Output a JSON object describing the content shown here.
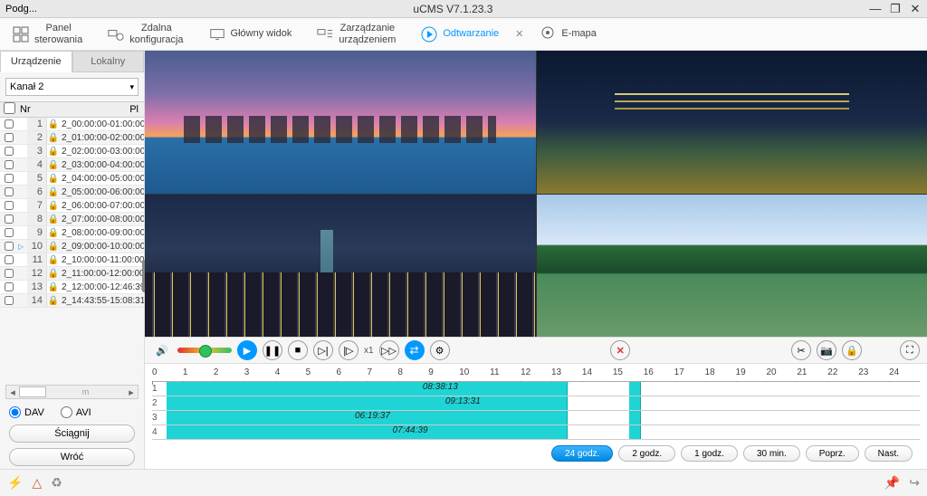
{
  "title_left": "Podg...",
  "title_center": "uCMS V7.1.23.3",
  "toolbar": {
    "panel": "Panel\nsterowania",
    "remote": "Zdalna\nkonfiguracja",
    "mainview": "Główny widok",
    "manage": "Zarządzanie\nurządzeniem",
    "playback": "Odtwarzanie",
    "emap": "E-mapa"
  },
  "side_tabs": {
    "device": "Urządzenie",
    "local": "Lokalny"
  },
  "channel": "Kanał 2",
  "list_header": {
    "nr": "Nr",
    "pl": "Pl"
  },
  "files": [
    {
      "n": "1",
      "name": "2_00:00:00-01:00:00"
    },
    {
      "n": "2",
      "name": "2_01:00:00-02:00:00"
    },
    {
      "n": "3",
      "name": "2_02:00:00-03:00:00"
    },
    {
      "n": "4",
      "name": "2_03:00:00-04:00:00"
    },
    {
      "n": "5",
      "name": "2_04:00:00-05:00:00"
    },
    {
      "n": "6",
      "name": "2_05:00:00-06:00:00"
    },
    {
      "n": "7",
      "name": "2_06:00:00-07:00:00"
    },
    {
      "n": "8",
      "name": "2_07:00:00-08:00:00"
    },
    {
      "n": "9",
      "name": "2_08:00:00-09:00:00"
    },
    {
      "n": "10",
      "name": "2_09:00:00-10:00:00",
      "playing": true
    },
    {
      "n": "11",
      "name": "2_10:00:00-11:00:00"
    },
    {
      "n": "12",
      "name": "2_11:00:00-12:00:00"
    },
    {
      "n": "13",
      "name": "2_12:00:00-12:46:39"
    },
    {
      "n": "14",
      "name": "2_14:43:55-15:08:31"
    }
  ],
  "scroll_marker": "m",
  "formats": {
    "dav": "DAV",
    "avi": "AVI"
  },
  "side_buttons": {
    "download": "Ściągnij",
    "back": "Wróć"
  },
  "speed": "x1",
  "timeline": {
    "hours": [
      "0",
      "1",
      "2",
      "3",
      "4",
      "5",
      "6",
      "7",
      "8",
      "9",
      "10",
      "11",
      "12",
      "13",
      "14",
      "15",
      "16",
      "17",
      "18",
      "19",
      "20",
      "21",
      "22",
      "23",
      "24"
    ],
    "stamps": {
      "r1": "08:38:13",
      "r2": "09:13:31",
      "r3": "06:19:37",
      "r4": "07:44:39"
    }
  },
  "zoom": {
    "h24": "24 godz.",
    "h2": "2 godz.",
    "h1": "1 godz.",
    "m30": "30 min.",
    "prev": "Poprz.",
    "next": "Nast."
  }
}
